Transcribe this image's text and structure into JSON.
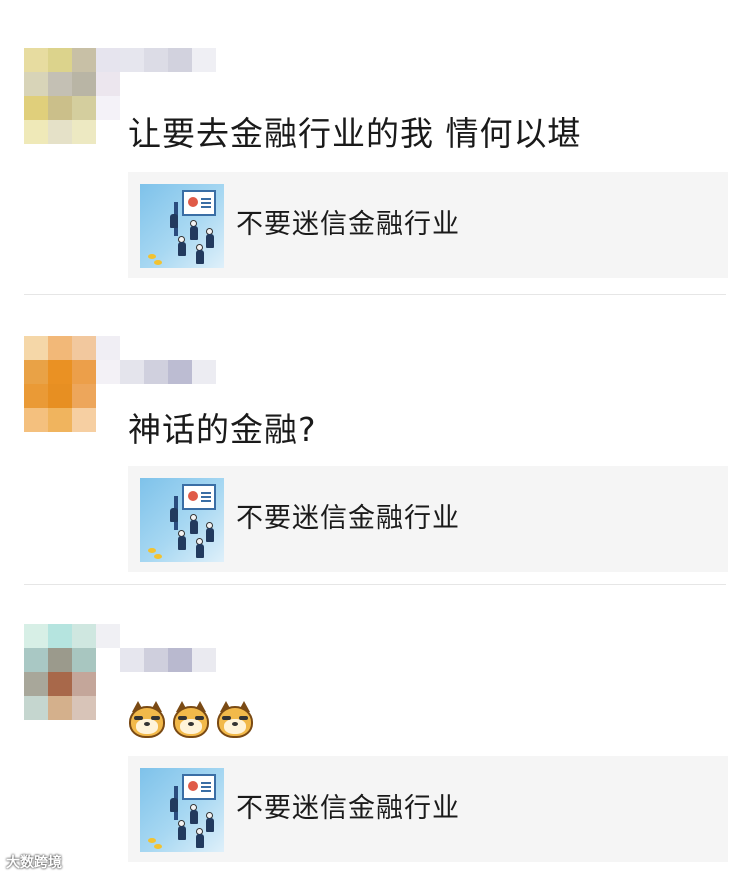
{
  "comments": [
    {
      "avatar_colors": [
        "#e7dca0",
        "#dcd38c",
        "#c8c0a6",
        "#e6e4ee",
        "#d8d4b8",
        "#c4c0b4",
        "#b9b5a5",
        "#ece6ee",
        "#e0cf7b",
        "#cbbf8a",
        "#d4ce9e",
        "#f4f2f8",
        "#efe9b8",
        "#e5e1c8",
        "#ede9c2",
        "#ffffff"
      ],
      "name_colors": [
        "#e6e6ee",
        "#dcdce6",
        "#d2d2de",
        "#efeff4"
      ],
      "text": "让要去金融行业的我 情何以堪",
      "share": {
        "title": "不要迷信金融行业",
        "thumb_icon": "finance-meeting-icon"
      }
    },
    {
      "avatar_colors": [
        "#f5d7a8",
        "#f2b878",
        "#f2c89e",
        "#f0eef4",
        "#e9a246",
        "#ea9123",
        "#ec9f4a",
        "#f3f1f6",
        "#ea9a36",
        "#e78f22",
        "#eda65b",
        "#ffffff",
        "#f4c07e",
        "#f0b45e",
        "#f6cfa2",
        "#ffffff"
      ],
      "name_colors": [
        "#e4e4ec",
        "#d0d0de",
        "#bcbcd2",
        "#ececf2"
      ],
      "text": "神话的金融?",
      "share": {
        "title": "不要迷信金融行业",
        "thumb_icon": "finance-meeting-icon"
      }
    },
    {
      "avatar_colors": [
        "#d7efe6",
        "#b5e4df",
        "#cfe7e0",
        "#f0f0f4",
        "#a9c8c4",
        "#9b9a8c",
        "#a8c6c0",
        "#ffffff",
        "#a8a79a",
        "#a8684a",
        "#c4a69a",
        "#ffffff",
        "#c5d6cf",
        "#d4b08c",
        "#d8c4b8",
        "#ffffff"
      ],
      "name_colors": [
        "#e6e6ee",
        "#cfcfdd",
        "#b9b9cf",
        "#eaeaf0"
      ],
      "text": "",
      "emoji": [
        "doge-emoji",
        "doge-emoji",
        "doge-emoji"
      ],
      "share": {
        "title": "不要迷信金融行业",
        "thumb_icon": "finance-meeting-icon"
      }
    }
  ],
  "watermark": "大数跨境"
}
